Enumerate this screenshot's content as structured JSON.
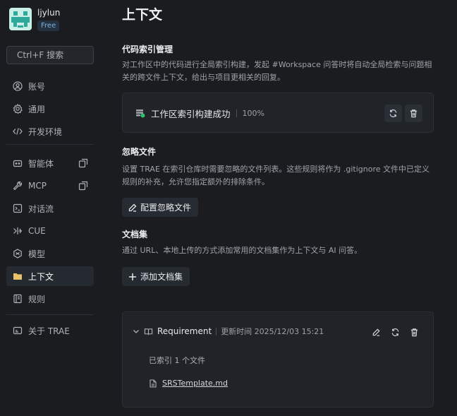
{
  "user": {
    "name": "ljylun",
    "plan": "Free"
  },
  "search": {
    "label": "Ctrl+F 搜索"
  },
  "nav": {
    "account": "账号",
    "general": "通用",
    "dev_env": "开发环境",
    "agents": "智能体",
    "mcp": "MCP",
    "chat_flow": "对话流",
    "cue": "CUE",
    "models": "模型",
    "context": "上下文",
    "rules": "规则",
    "about": "关于 TRAE"
  },
  "page": {
    "title": "上下文"
  },
  "code_index": {
    "title": "代码索引管理",
    "desc": "对工作区中的代码进行全局索引构建，发起 #Workspace 问答时将自动全局检索与问题相关的跨文件上下文，给出与项目更相关的回复。",
    "status": "工作区索引构建成功",
    "progress": "100%"
  },
  "ignore": {
    "title": "忽略文件",
    "desc": "设置 TRAE 在索引仓库时需要忽略的文件列表。这些规则将作为 .gitignore 文件中已定义规则的补充，允许您指定额外的排除条件。",
    "button": "配置忽略文件"
  },
  "docs": {
    "title": "文档集",
    "desc": "通过 URL、本地上传的方式添加常用的文档集作为上下文与 AI 问答。",
    "button": "添加文档集",
    "item": {
      "name": "Requirement",
      "updated": "更新时间 2025/12/03 15:21",
      "indexed": "已索引 1 个文件",
      "file": "SRSTemplate.md"
    }
  },
  "colors": {
    "background": "#1b1c1f",
    "active_nav": "#252a31",
    "success": "#2fbf71",
    "badge": "#7cb3d9"
  }
}
